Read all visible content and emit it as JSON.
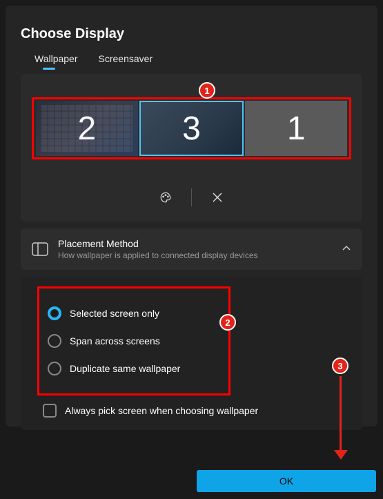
{
  "title": "Choose Display",
  "tabs": {
    "wallpaper": "Wallpaper",
    "screensaver": "Screensaver",
    "active": "wallpaper"
  },
  "monitors": {
    "left": "2",
    "center": "3",
    "right": "1",
    "selected": "3"
  },
  "toolbar": {
    "palette": "palette-icon",
    "close": "close-icon"
  },
  "placement": {
    "title": "Placement Method",
    "subtitle": "How wallpaper is applied to connected display devices"
  },
  "options": {
    "selected_only": "Selected screen only",
    "span": "Span across screens",
    "duplicate": "Duplicate same wallpaper",
    "choice": "selected_only"
  },
  "always_pick": "Always pick screen when choosing wallpaper",
  "buttons": {
    "ok": "OK"
  },
  "callouts": {
    "one": "1",
    "two": "2",
    "three": "3"
  }
}
